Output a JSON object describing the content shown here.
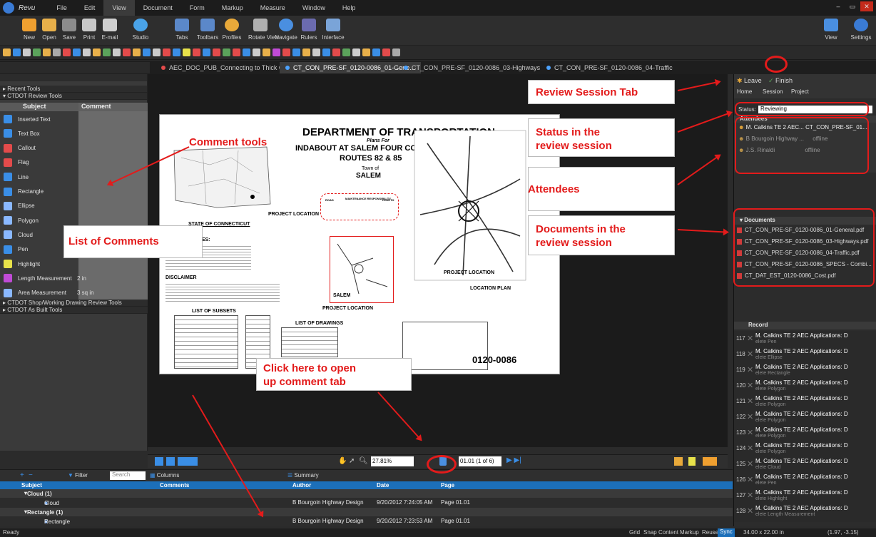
{
  "app": {
    "name": "Revu"
  },
  "menu": [
    "File",
    "Edit",
    "View",
    "Document",
    "Form",
    "Markup",
    "Measure",
    "Window",
    "Help"
  ],
  "ribbon_left": [
    "New",
    "Open",
    "Save",
    "Print",
    "E-mail",
    "Studio"
  ],
  "ribbon_mid": [
    "Tabs",
    "Toolbars",
    "Profiles",
    "Rotate View",
    "Navigate",
    "Rulers",
    "Interface"
  ],
  "ribbon_right": [
    "View",
    "Settings"
  ],
  "doc_tabs": [
    "AEC_DOC_PUB_Connecting to Thick Clien",
    "CT_CON_PRE-SF_0120-0086_01-Gene...",
    "CT_CON_PRE-SF_0120-0086_03-Highways",
    "CT_CON_PRE-SF_0120-0086_04-Traffic"
  ],
  "left_panel": {
    "sections": [
      "Recent Tools",
      "CTDOT Review Tools",
      "CTDOT Shop/Working Drawing Review Tools",
      "CTDOT As Built Tools"
    ],
    "col_subject": "Subject",
    "col_comment": "Comment",
    "tools": [
      {
        "name": "Inserted Text",
        "comment": "",
        "icon": "inserted-text-icon",
        "color": "#3a8ee6"
      },
      {
        "name": "Text Box",
        "comment": "",
        "icon": "text-box-icon",
        "color": "#3a8ee6"
      },
      {
        "name": "Callout",
        "comment": "",
        "icon": "callout-icon",
        "color": "#e34b4b"
      },
      {
        "name": "Flag",
        "comment": "",
        "icon": "flag-icon",
        "color": "#e34b4b"
      },
      {
        "name": "Line",
        "comment": "",
        "icon": "line-icon",
        "color": "#3a8ee6"
      },
      {
        "name": "Rectangle",
        "comment": "",
        "icon": "rectangle-icon",
        "color": "#3a8ee6"
      },
      {
        "name": "Ellipse",
        "comment": "",
        "icon": "ellipse-icon",
        "color": "#8ab8ff"
      },
      {
        "name": "Polygon",
        "comment": "",
        "icon": "polygon-icon",
        "color": "#8ab8ff"
      },
      {
        "name": "Cloud",
        "comment": "",
        "icon": "cloud-icon",
        "color": "#8ab8ff"
      },
      {
        "name": "Pen",
        "comment": "",
        "icon": "pen-icon",
        "color": "#3a8ee6"
      },
      {
        "name": "Highlight",
        "comment": "",
        "icon": "highlight-icon",
        "color": "#e8e24a"
      },
      {
        "name": "Length Measurement",
        "comment": "2 in",
        "icon": "length-measurement-icon",
        "color": "#c04bd6"
      },
      {
        "name": "Area Measurement",
        "comment": "3 sq in",
        "icon": "area-measurement-icon",
        "color": "#8ab8ff"
      }
    ]
  },
  "drawing": {
    "title": "DEPARTMENT OF TRANSPORTATION",
    "plans_for": "Plans For",
    "project": "INDABOUT AT SALEM FOUR CORNERS",
    "routes": "ROUTES 82 & 85",
    "town_of": "Town of",
    "town": "SALEM",
    "state": "STATE OF CONNECTICUT",
    "project_location": "PROJECT LOCATION",
    "general_notes": "GENERAL NOTES:",
    "disclaimer": "DISCLAIMER",
    "list_subsets": "LIST OF SUBSETS",
    "list_drawings": "LIST OF DRAWINGS",
    "location_plan": "LOCATION PLAN",
    "project_num": "0120-0086",
    "table_head": [
      "ROAD",
      "MAINTENANCE RESPONSIBILITY",
      "LENGTH"
    ]
  },
  "annotations": {
    "comment_tools": "Comment tools",
    "review_session_tab": "Review Session Tab",
    "status": "Status in the\nreview session",
    "attendees": "Attendees",
    "documents": "Documents in the\nreview session",
    "list_of_comments": "List of Comments",
    "click_here": "Click here to open\nup comment tab"
  },
  "bottom_bar": {
    "zoom": "27.81%",
    "page": "01.01 (1 of 6)"
  },
  "right_panel": {
    "leave": "Leave",
    "finish": "Finish",
    "home": "Home",
    "session": "Session",
    "project": "Project",
    "status_label": "Status:",
    "status_value": "Reviewing",
    "attendees_header": "Attendees",
    "attendees": [
      {
        "name": "M. Calkins TE 2 AEC...",
        "doc": "CT_CON_PRE-SF_01...",
        "color": "#e8a93a"
      },
      {
        "name": "B Bourgoin Highway ...",
        "doc": "offline",
        "color": "#c49a4a"
      },
      {
        "name": "J.S. Rinaldi",
        "doc": "offline",
        "color": "#c49a4a"
      }
    ],
    "documents_header": "Documents",
    "documents": [
      "CT_CON_PRE-SF_0120-0086_01-General.pdf",
      "CT_CON_PRE-SF_0120-0086_03-Highways.pdf",
      "CT_CON_PRE-SF_0120-0086_04-Traffic.pdf",
      "CT_CON_PRE-SF_0120-0086_SPECS - Combi...",
      "CT_DAT_EST_0120-0086_Cost.pdf"
    ],
    "record_header": "Record",
    "records": [
      {
        "num": "117",
        "who": "M. Calkins TE 2 AEC Applications: D",
        "act": "elete Pen"
      },
      {
        "num": "118",
        "who": "M. Calkins TE 2 AEC Applications: D",
        "act": "elete Ellipse"
      },
      {
        "num": "119",
        "who": "M. Calkins TE 2 AEC Applications: D",
        "act": "elete Rectangle"
      },
      {
        "num": "120",
        "who": "M. Calkins TE 2 AEC Applications: D",
        "act": "elete Polygon"
      },
      {
        "num": "121",
        "who": "M. Calkins TE 2 AEC Applications: D",
        "act": "elete Polygon"
      },
      {
        "num": "122",
        "who": "M. Calkins TE 2 AEC Applications: D",
        "act": "elete Polygon"
      },
      {
        "num": "123",
        "who": "M. Calkins TE 2 AEC Applications: D",
        "act": "elete Polygon"
      },
      {
        "num": "124",
        "who": "M. Calkins TE 2 AEC Applications: D",
        "act": "elete Polygon"
      },
      {
        "num": "125",
        "who": "M. Calkins TE 2 AEC Applications: D",
        "act": "elete Cloud"
      },
      {
        "num": "126",
        "who": "M. Calkins TE 2 AEC Applications: D",
        "act": "elete Pen"
      },
      {
        "num": "127",
        "who": "M. Calkins TE 2 AEC Applications: D",
        "act": "elete Highlight"
      },
      {
        "num": "128",
        "who": "M. Calkins TE 2 AEC Applications: D",
        "act": "elete Length Measurement"
      }
    ]
  },
  "comments_toolbar": {
    "filter": "Filter",
    "search_placeholder": "Search",
    "columns": "Columns",
    "summary": "Summary"
  },
  "comments_list": {
    "headers": [
      "Subject",
      "Comments",
      "Author",
      "Date",
      "Page"
    ],
    "rows": [
      {
        "type": "group",
        "subject": "Cloud (1)"
      },
      {
        "type": "item",
        "subject": "Cloud",
        "author": "B Bourgoin Highway Design",
        "date": "9/20/2012 7:24:05 AM",
        "page": "Page 01.01"
      },
      {
        "type": "group",
        "subject": "Rectangle (1)"
      },
      {
        "type": "item",
        "subject": "Rectangle",
        "author": "B Bourgoin Highway Design",
        "date": "9/20/2012 7:23:53 AM",
        "page": "Page 01.01"
      }
    ]
  },
  "status_bar": {
    "ready": "Ready",
    "toggles": [
      "Grid",
      "Snap",
      "Content",
      "Markup",
      "Reuse",
      "Sync"
    ],
    "size": "34.00 x 22.00 in",
    "coords": "(1.97, -3.15)"
  },
  "colors": {
    "accent": "#1c6fb9",
    "callout": "#e31b1b"
  }
}
